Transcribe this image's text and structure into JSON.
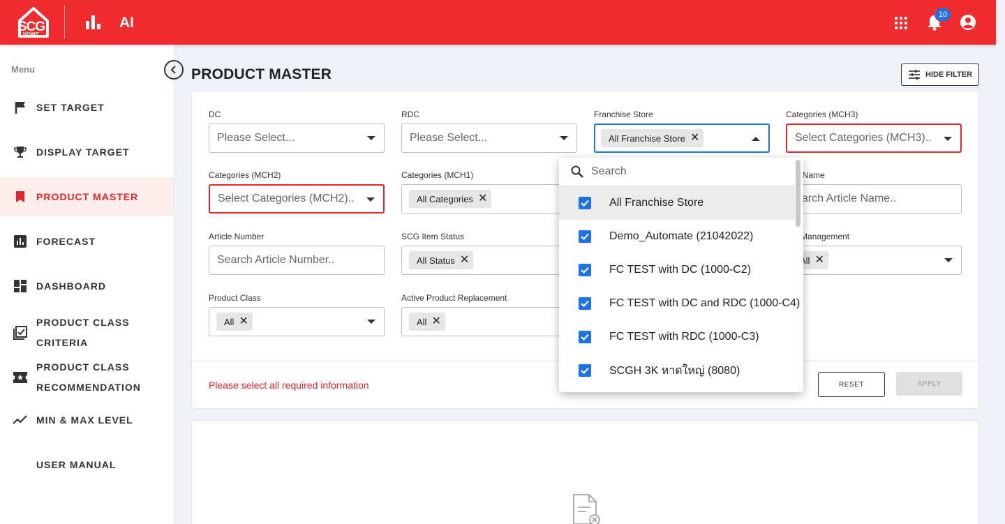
{
  "header": {
    "logo_main": "SCG",
    "logo_sub": "HOME",
    "app_name": "AI",
    "notification_count": "10"
  },
  "sidebar": {
    "menu_label": "Menu",
    "items": [
      {
        "label": "SET TARGET",
        "icon": "flag-icon"
      },
      {
        "label": "DISPLAY TARGET",
        "icon": "trophy-icon"
      },
      {
        "label": "PRODUCT MASTER",
        "icon": "bookmark-icon",
        "active": true
      },
      {
        "label": "FORECAST",
        "icon": "bar-chart-icon"
      },
      {
        "label": "DASHBOARD",
        "icon": "dashboard-icon"
      },
      {
        "label_line1": "PRODUCT CLASS",
        "label_line2": "CRITERIA",
        "icon": "checklist-icon"
      },
      {
        "label_line1": "PRODUCT CLASS",
        "label_line2": "RECOMMENDATION",
        "icon": "ticket-icon"
      },
      {
        "label": "MIN & MAX LEVEL",
        "icon": "trend-icon"
      },
      {
        "label": "USER MANUAL",
        "icon": ""
      }
    ]
  },
  "main": {
    "title": "PRODUCT MASTER",
    "hide_filter_label": "HIDE FILTER",
    "filters": {
      "dc": {
        "label": "DC",
        "placeholder": "Please Select..."
      },
      "rdc": {
        "label": "RDC",
        "placeholder": "Please Select..."
      },
      "franchise_store": {
        "label": "Franchise Store",
        "chip": "All Franchise Store"
      },
      "mch3": {
        "label": "Categories (MCH3)",
        "placeholder": "Select Categories (MCH3).."
      },
      "mch2": {
        "label": "Categories (MCH2)",
        "placeholder": "Select Categories (MCH2).."
      },
      "mch1": {
        "label": "Categories (MCH1)",
        "chip": "All Categories"
      },
      "article_name": {
        "label": "le Name",
        "placeholder": "earch Article Name.."
      },
      "article_number": {
        "label": "Article Number",
        "placeholder": "Search Article Number.."
      },
      "item_status": {
        "label": "SCG Item Status",
        "chip": "All Status"
      },
      "management": {
        "label": "h Management",
        "chip": "All"
      },
      "product_class": {
        "label": "Product Class",
        "chip": "All"
      },
      "active_replacement": {
        "label": "Active Product Replacement",
        "chip": "All"
      }
    },
    "error_message": "Please select all required information",
    "reset_label": "RESET",
    "apply_label": "APPLY"
  },
  "dropdown": {
    "search_placeholder": "Search",
    "options": [
      {
        "label": "All Franchise Store",
        "checked": true
      },
      {
        "label": "Demo_Automate (21042022)",
        "checked": true
      },
      {
        "label": "FC TEST with DC (1000-C2)",
        "checked": true
      },
      {
        "label": "FC TEST with DC and RDC (1000-C4)",
        "checked": true
      },
      {
        "label": "FC TEST with RDC (1000-C3)",
        "checked": true
      },
      {
        "label": "SCGH 3K หาดใหญ่ (8080)",
        "checked": true
      }
    ]
  },
  "colors": {
    "brand_red": "#ef2b2d",
    "active_red": "#e2252a",
    "checkbox_blue": "#1a73e8"
  }
}
